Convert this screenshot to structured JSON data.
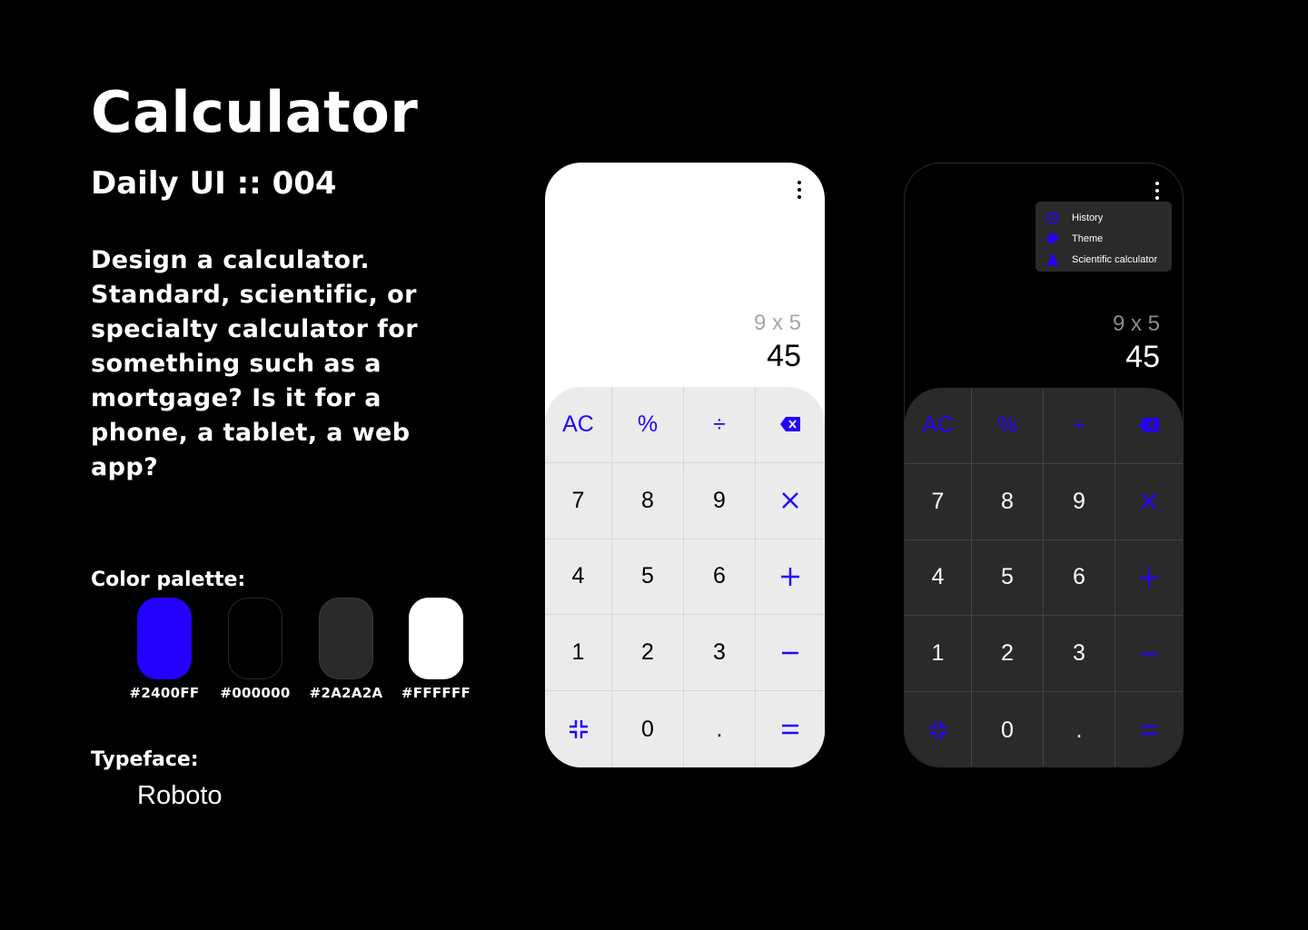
{
  "header": {
    "title": "Calculator",
    "subtitle": "Daily UI :: 004",
    "brief": "Design a calculator. Standard, scientific, or specialty calculator for something such as a mortgage? Is it for a phone, a tablet, a web app?"
  },
  "palette": {
    "label": "Color palette:",
    "swatches": [
      {
        "code": "#2400FF",
        "color": "#2400FF"
      },
      {
        "code": "#000000",
        "color": "#000000"
      },
      {
        "code": "#2A2A2A",
        "color": "#2A2A2A"
      },
      {
        "code": "#FFFFFF",
        "color": "#FFFFFF"
      }
    ]
  },
  "typeface": {
    "label": "Typeface:",
    "value": "Roboto"
  },
  "calculator": {
    "expression": "9 x 5",
    "result": "45",
    "keys": {
      "clear": "AC",
      "percent": "%",
      "divide": "÷",
      "n7": "7",
      "n8": "8",
      "n9": "9",
      "n4": "4",
      "n5": "5",
      "n6": "6",
      "n1": "1",
      "n2": "2",
      "n3": "3",
      "n0": "0",
      "dot": "."
    },
    "icons": [
      "backspace-icon",
      "multiply-icon",
      "plus-icon",
      "minus-icon",
      "collapse-icon",
      "equals-icon",
      "more-vert-icon"
    ]
  },
  "menu": {
    "items": [
      {
        "label": "History",
        "icon": "history-icon"
      },
      {
        "label": "Theme",
        "icon": "palette-icon"
      },
      {
        "label": "Scientific calculator",
        "icon": "flask-icon"
      }
    ]
  },
  "colors": {
    "accent": "#2400FF",
    "background": "#000000",
    "surface_dark": "#2A2A2A",
    "surface_light": "#FFFFFF"
  }
}
